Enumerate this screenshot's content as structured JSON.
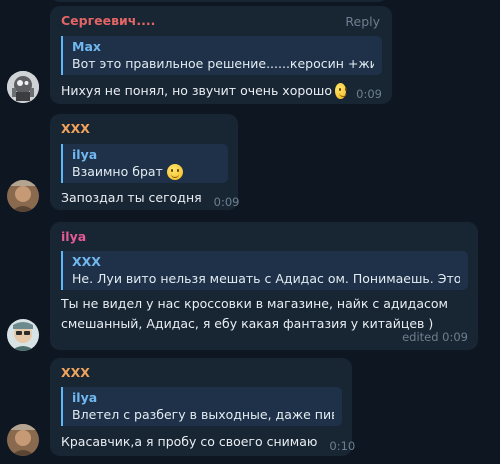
{
  "messages": [
    {
      "sender": "Сергеевич....",
      "sender_color": "#e36565",
      "reply_label": "Reply",
      "quote_author": "Max",
      "quote_text": "Вот это правильное решение......керосин +жидк...",
      "text": "Нихуя не понял, но звучит очень хорошо",
      "emoji": "grinning-face",
      "time": "0:09"
    },
    {
      "sender": "XXX",
      "sender_color": "#f0a35c",
      "quote_author": "ilya",
      "quote_text": "Взаимно брат",
      "quote_emoji": "smiling-face",
      "text": "Запоздал ты сегодня",
      "time": "0:09"
    },
    {
      "sender": "ilya",
      "sender_color": "#e35b97",
      "quote_author": "XXX",
      "quote_text": "Не. Луи вито нельзя мешать с Адидас ом. Понимаешь. Это ма...",
      "text_line1": "Ты не видел у нас кроссовки  в магазине, найк с адидасом",
      "text_line2": "смешанный,  Адидас, я ебу какая фантазия у китайцев )",
      "time": "edited 0:09"
    },
    {
      "sender": "XXX",
      "sender_color": "#f0a35c",
      "quote_author": "ilya",
      "quote_text": "Влетел с разбегу в выходные, даже пивка...",
      "text": "Красавчик,а я пробу со своего снимаю",
      "time": "0:10"
    }
  ]
}
